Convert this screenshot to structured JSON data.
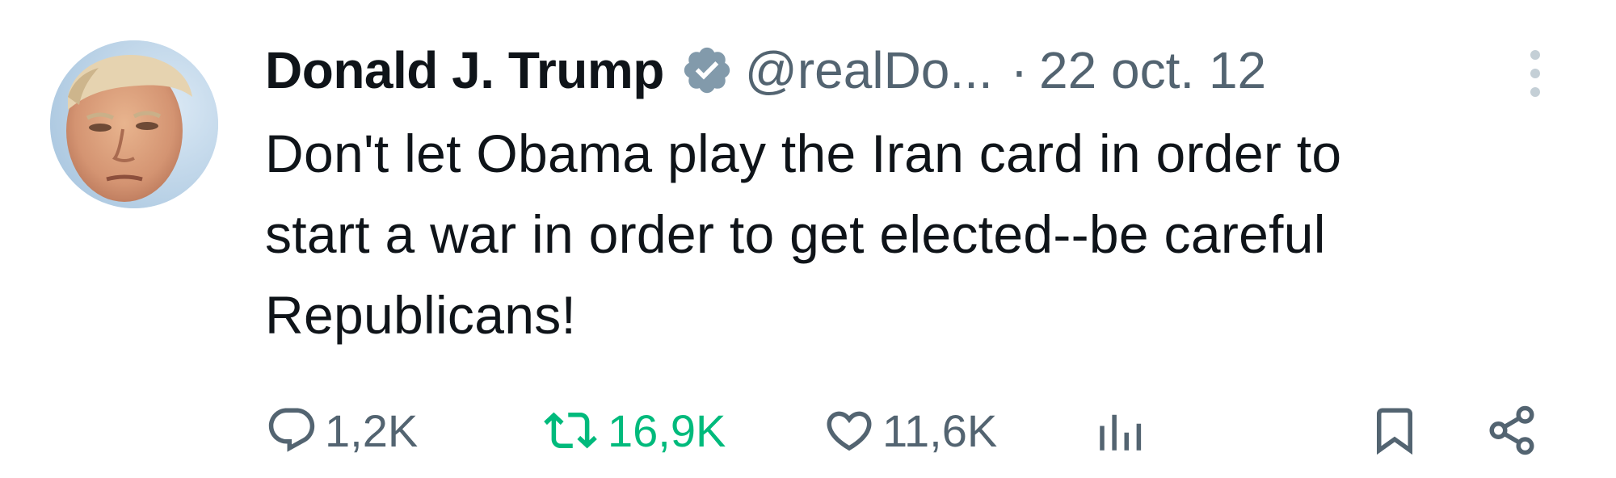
{
  "tweet": {
    "author": {
      "display_name": "Donald J. Trump",
      "handle": "@realDo...",
      "verified": true,
      "avatar_icon": "profile-photo"
    },
    "separator": "·",
    "timestamp": "22 oct. 12",
    "text_lines": [
      "Don't let Obama play the Iran card in order to",
      "start a war in order to get elected--be careful",
      "Republicans!"
    ],
    "actions": {
      "reply_count": "1,2K",
      "retweet_count": "16,9K",
      "like_count": "11,6K",
      "views_icon": "bar-chart-icon",
      "bookmark_icon": "bookmark-icon",
      "share_icon": "share-icon"
    }
  },
  "colors": {
    "text": "#0f1419",
    "muted": "#536471",
    "retweet_active": "#00ba7c",
    "verified_badge": "#829aab"
  }
}
